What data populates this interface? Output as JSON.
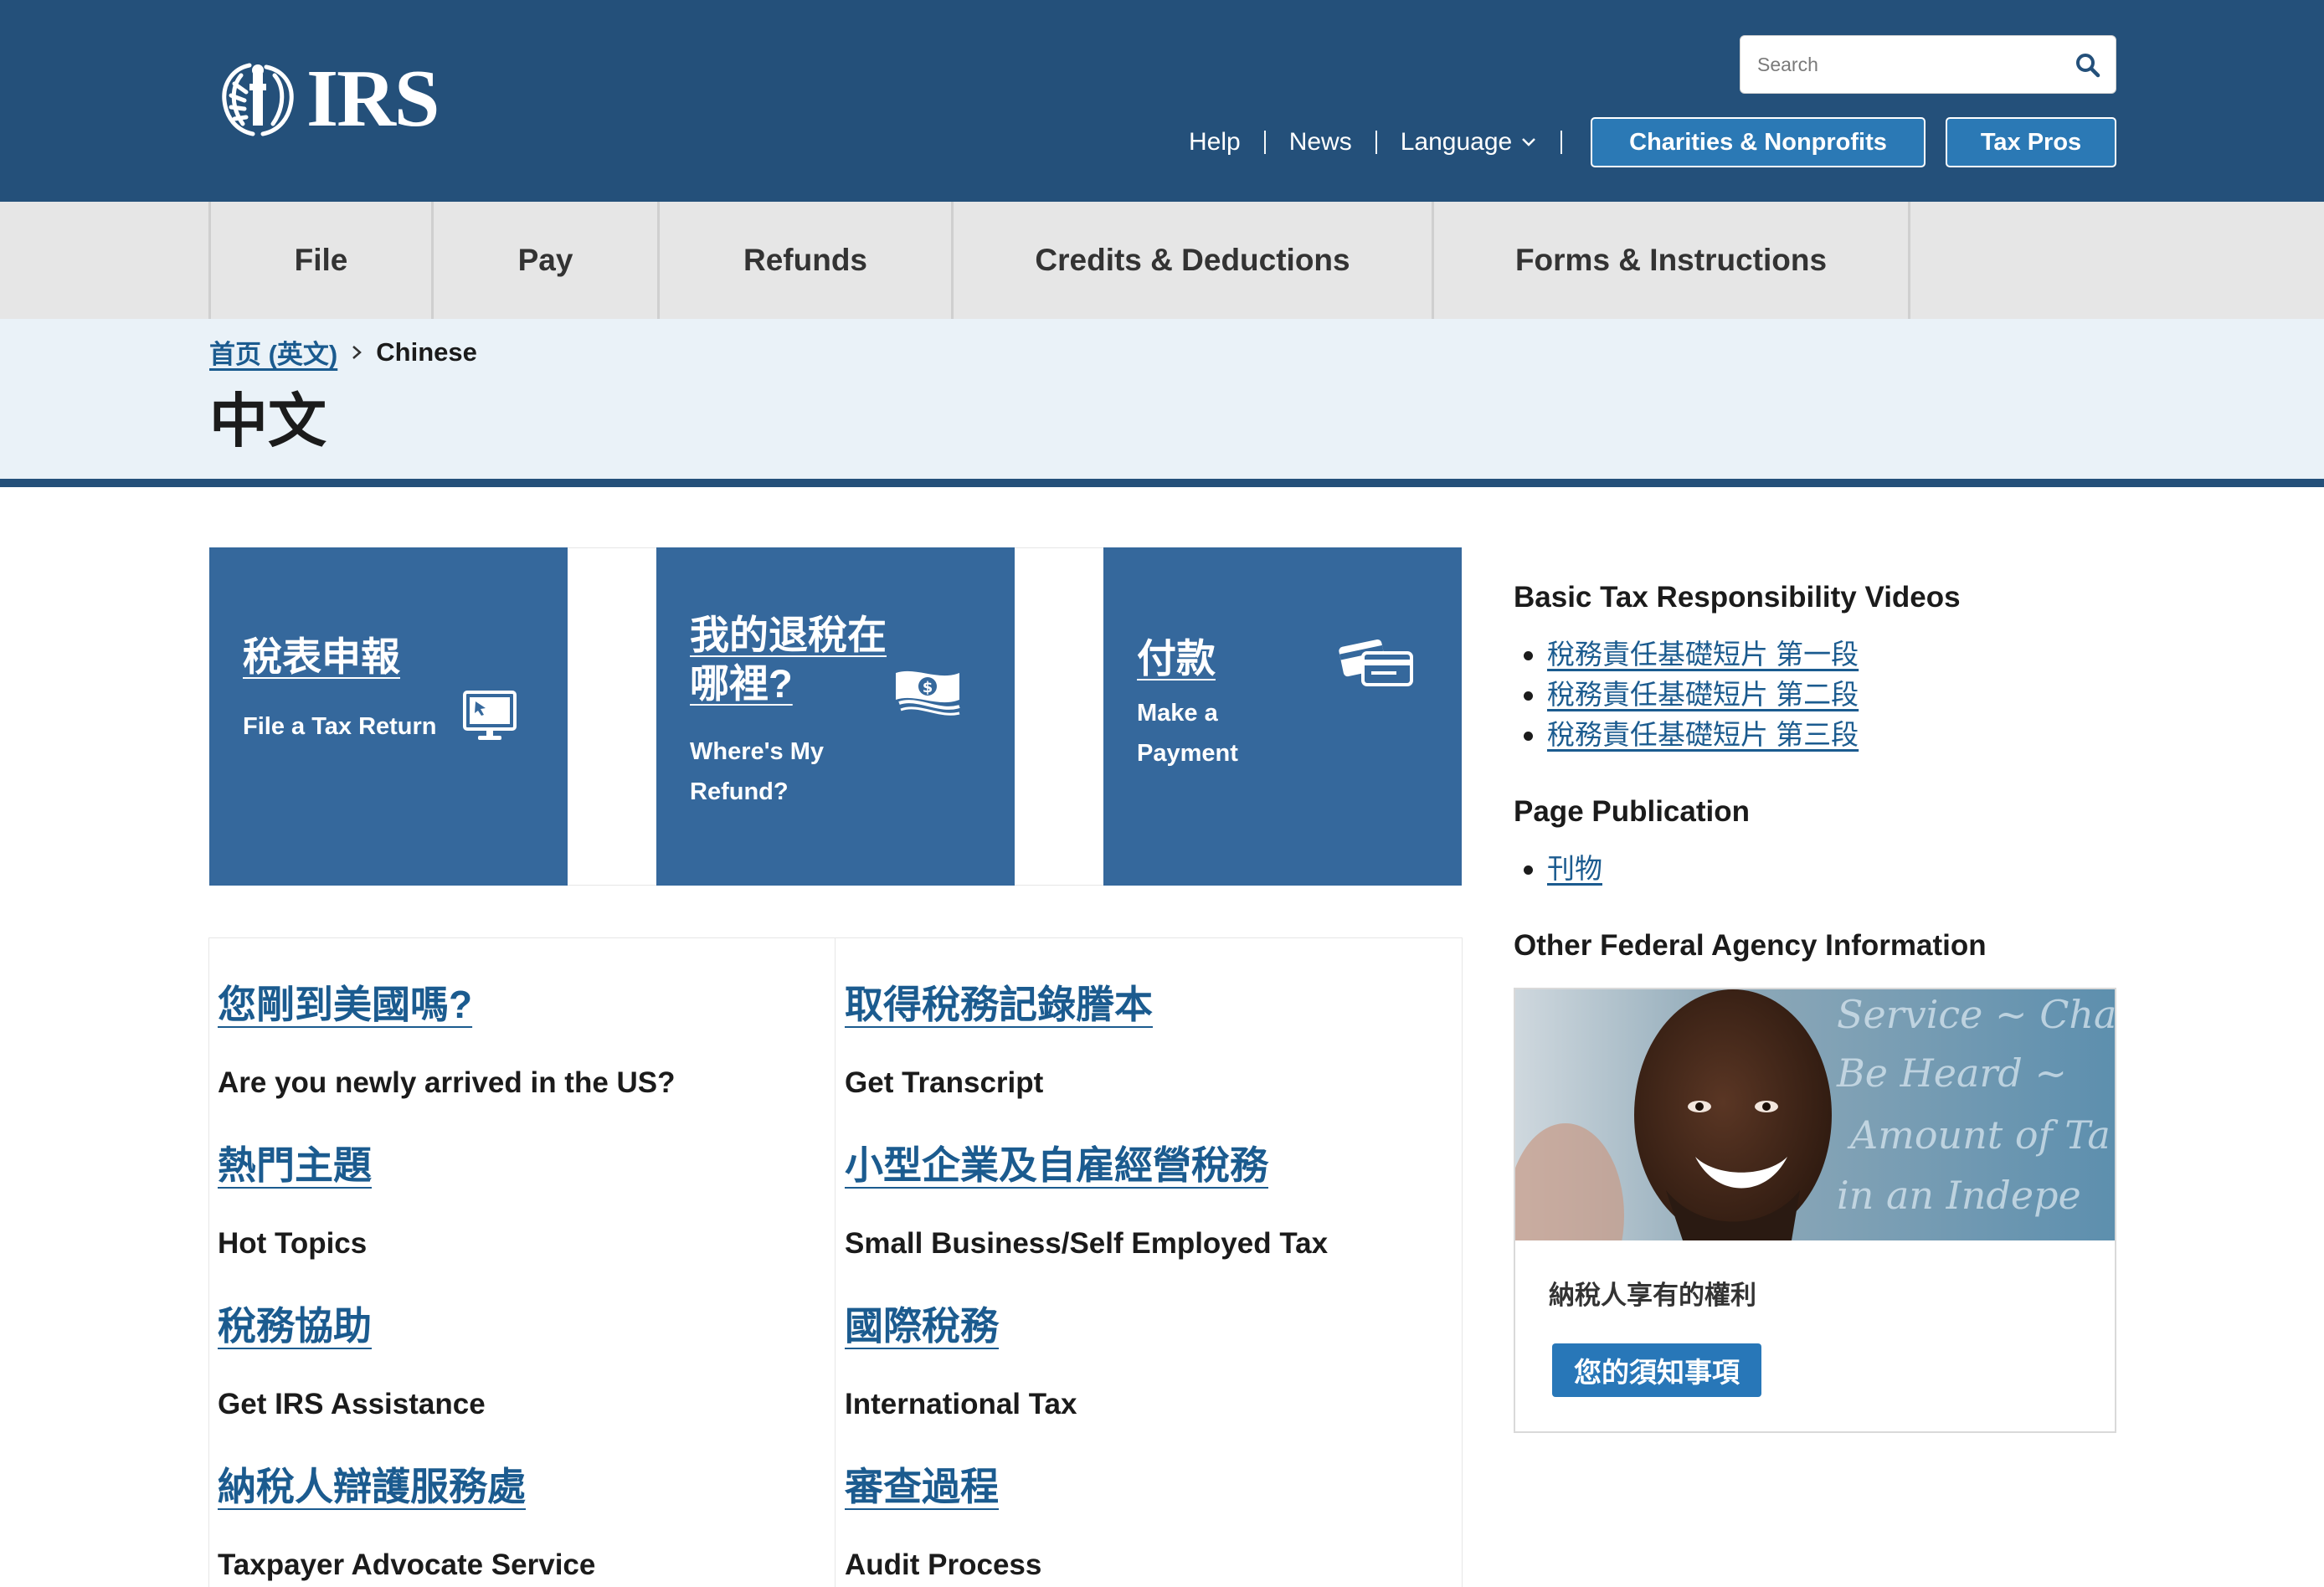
{
  "header": {
    "logo_text": "IRS",
    "search_placeholder": "Search",
    "utility_links": {
      "help": "Help",
      "news": "News",
      "language": "Language"
    },
    "buttons": {
      "charities": "Charities & Nonprofits",
      "tax_pros": "Tax Pros"
    }
  },
  "main_nav": {
    "tabs": [
      "File",
      "Pay",
      "Refunds",
      "Credits & Deductions",
      "Forms & Instructions"
    ]
  },
  "breadcrumb": {
    "home": "首页 (英文)",
    "current": "Chinese"
  },
  "page_title": "中文",
  "tiles": [
    {
      "zh": "稅表申報",
      "en": "File a Tax Return",
      "icon": "computer-icon"
    },
    {
      "zh_line1": "我的退稅在",
      "zh_line2": "哪裡?",
      "en_line1": "Where's My",
      "en_line2": "Refund?",
      "icon": "money-icon"
    },
    {
      "zh": "付款",
      "en_line1": "Make a",
      "en_line2": "Payment",
      "icon": "credit-card-icon"
    }
  ],
  "grid_links": {
    "left": [
      {
        "zh": "您剛到美國嗎?",
        "en": "Are you newly arrived in the US?"
      },
      {
        "zh": "熱門主題",
        "en": "Hot Topics"
      },
      {
        "zh": "稅務協助",
        "en": "Get IRS Assistance"
      },
      {
        "zh": "納稅人辯護服務處",
        "en": "Taxpayer Advocate Service"
      }
    ],
    "right": [
      {
        "zh": "取得稅務記錄謄本",
        "en": "Get Transcript"
      },
      {
        "zh": "小型企業及自雇經營稅務",
        "en": "Small Business/Self Employed Tax"
      },
      {
        "zh": "國際稅務",
        "en": "International Tax"
      },
      {
        "zh": "審查過程",
        "en": "Audit Process"
      }
    ]
  },
  "sidebar": {
    "videos_heading": "Basic Tax Responsibility Videos",
    "videos": [
      "稅務責任基礎短片 第一段",
      "稅務責任基礎短片 第二段",
      "稅務責任基礎短片 第三段"
    ],
    "publication_heading": "Page Publication",
    "publications": [
      "刊物"
    ],
    "agency_heading": "Other Federal Agency Information",
    "card_text": "納稅人享有的權利",
    "card_button": "您的須知事項",
    "card_photo_script": [
      "Service ~ Cha",
      "Be Heard ~",
      "Amount of Ta",
      "in an Indepe"
    ]
  },
  "colors": {
    "header_bg": "#24507a",
    "tile_bg": "#35689c",
    "link": "#1b5b8f",
    "nav_bg": "#e6e6e6",
    "title_band_bg": "#eaf2f8"
  }
}
